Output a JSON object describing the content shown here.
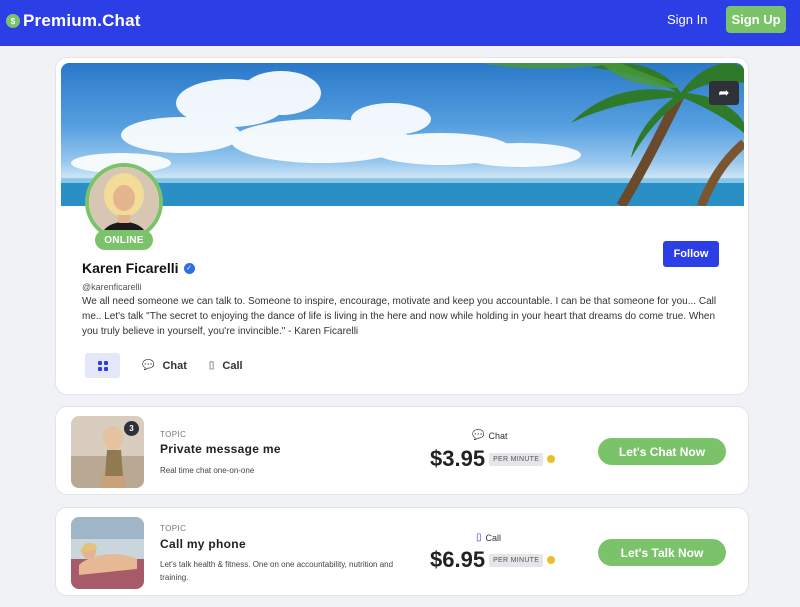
{
  "header": {
    "logo_badge": "$",
    "logo_text": "Premium.Chat",
    "signin_label": "Sign In",
    "signup_label": "Sign Up"
  },
  "profile": {
    "share_icon": "share-arrow-icon",
    "status": "ONLINE",
    "name": "Karen Ficarelli",
    "handle": "@karenficarelli",
    "bio": "We all need someone we can talk to. Someone to inspire, encourage, motivate and keep you accountable. I can be that someone for you... Call me.. Let's talk \"The secret to enjoying the dance of life is living in the here and now while holding in your heart that dreams do come true. When you truly believe in yourself, you're invincible.\" - Karen Ficarelli",
    "follow_label": "Follow",
    "tabs": [
      {
        "label": "",
        "icon": "grid-icon"
      },
      {
        "label": "Chat",
        "icon": "chat-icon"
      },
      {
        "label": "Call",
        "icon": "phone-icon"
      }
    ]
  },
  "offers": [
    {
      "thumb_count": "3",
      "topic_label": "TOPIC",
      "title": "Private message me",
      "description": "Real time chat one-on-one",
      "type": "Chat",
      "type_icon": "chat-bubbles-icon",
      "price": "$3.95",
      "per_minute": "PER MINUTE",
      "cta": "Let's Chat Now"
    },
    {
      "topic_label": "TOPIC",
      "title": "Call my phone",
      "description": "Let's talk health & fitness. One on one accountability, nutrition and training.",
      "type": "Call",
      "type_icon": "phone-icon",
      "price": "$6.95",
      "per_minute": "PER MINUTE",
      "cta": "Let's Talk Now"
    }
  ],
  "colors": {
    "brand_blue": "#2c3ee6",
    "accent_green": "#7ac36a",
    "coin_gold": "#e6c02a"
  }
}
